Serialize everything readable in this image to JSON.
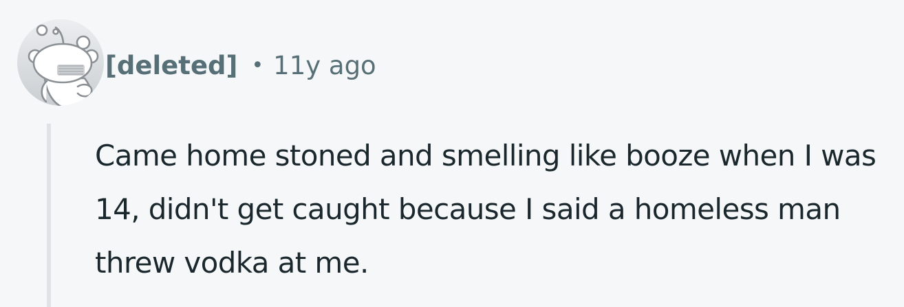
{
  "comment": {
    "author": "[deleted]",
    "separator": "•",
    "timestamp": "11y ago",
    "body": "Came home stoned and smelling like booze when I was 14, didn't get caught because I said a homeless man threw vodka at me.",
    "avatar_icon": "snoo-avatar-icon"
  },
  "colors": {
    "background": "#f6f7f8",
    "meta_text": "#576f76",
    "body_text": "#1a282d",
    "thread_line": "#dfe3e6"
  }
}
